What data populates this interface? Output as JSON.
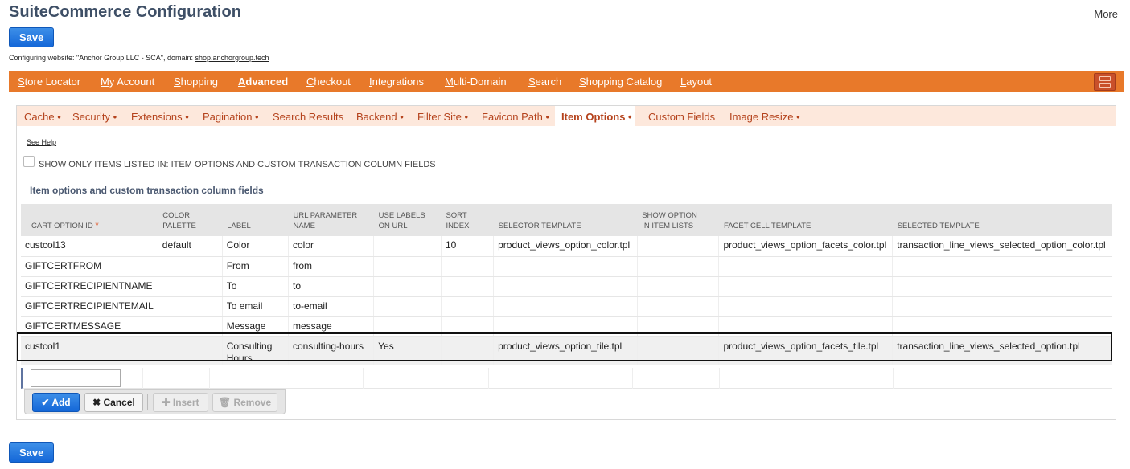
{
  "header": {
    "title": "SuiteCommerce Configuration",
    "more_label": "More",
    "save_label": "Save",
    "configuring_prefix": "Configuring website: \"Anchor Group LLC - SCA\", domain: ",
    "configuring_domain": "shop.anchorgroup.tech"
  },
  "nav": {
    "items": [
      "Store Locator",
      "My Account",
      "Shopping",
      "Advanced",
      "Checkout",
      "Integrations",
      "Multi-Domain",
      "Search",
      "Shopping Catalog",
      "Layout"
    ],
    "active": "Advanced"
  },
  "subtabs": {
    "items": [
      "Cache •",
      "Security •",
      "Extensions •",
      "Pagination •",
      "Search Results",
      "Backend •",
      "Filter Site •",
      "Favicon Path •",
      "Item Options •",
      "Custom Fields",
      "Image Resize •"
    ],
    "active": "Item Options •"
  },
  "content": {
    "see_help": "See Help",
    "checkbox_label": "SHOW ONLY ITEMS LISTED IN: ITEM OPTIONS AND CUSTOM TRANSACTION COLUMN FIELDS",
    "section_title": "Item options and custom transaction column fields"
  },
  "table": {
    "columns": [
      {
        "line1": "CART OPTION ID",
        "line2": "",
        "required": "*"
      },
      {
        "line1": "COLOR",
        "line2": "PALETTE"
      },
      {
        "line1": "LABEL",
        "line2": ""
      },
      {
        "line1": "URL PARAMETER",
        "line2": "NAME"
      },
      {
        "line1": "USE LABELS",
        "line2": "ON URL"
      },
      {
        "line1": "SORT",
        "line2": "INDEX"
      },
      {
        "line1": "SELECTOR TEMPLATE",
        "line2": ""
      },
      {
        "line1": "SHOW OPTION",
        "line2": "IN ITEM LISTS"
      },
      {
        "line1": "FACET CELL TEMPLATE",
        "line2": ""
      },
      {
        "line1": "SELECTED TEMPLATE",
        "line2": ""
      }
    ],
    "rows": [
      [
        "custcol13",
        "default",
        "Color",
        "color",
        "",
        "10",
        "product_views_option_color.tpl",
        "",
        "product_views_option_facets_color.tpl",
        "transaction_line_views_selected_option_color.tpl"
      ],
      [
        "GIFTCERTFROM",
        "",
        "From",
        "from",
        "",
        "",
        "",
        "",
        "",
        ""
      ],
      [
        "GIFTCERTRECIPIENTNAME",
        "",
        "To",
        "to",
        "",
        "",
        "",
        "",
        "",
        ""
      ],
      [
        "GIFTCERTRECIPIENTEMAIL",
        "",
        "To email",
        "to-email",
        "",
        "",
        "",
        "",
        "",
        ""
      ],
      [
        "GIFTCERTMESSAGE",
        "",
        "Message",
        "message",
        "",
        "",
        "",
        "",
        "",
        ""
      ],
      [
        "custcol1",
        "",
        "Consulting Hours",
        "consulting-hours",
        "Yes",
        "",
        "product_views_option_tile.tpl",
        "",
        "product_views_option_facets_tile.tpl",
        "transaction_line_views_selected_option.tpl"
      ]
    ],
    "selected_row": 5
  },
  "edit_bar": {
    "add_label": "Add",
    "cancel_label": "Cancel",
    "insert_label": "Insert",
    "remove_label": "Remove"
  },
  "colors": {
    "nav_bg": "#e8792a",
    "subtab_bg": "#fde8dc",
    "subtab_text": "#b5431d",
    "accent_blue": "#1467d8"
  }
}
